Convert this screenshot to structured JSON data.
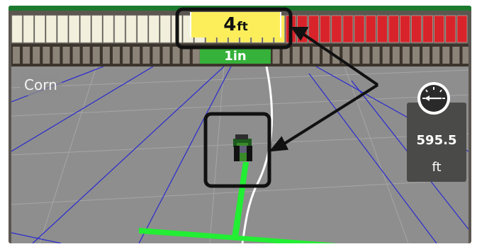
{
  "lightbar": {
    "offset_value": "4",
    "offset_unit": "ft",
    "left_color": "#f2f0dc",
    "right_color": "#d9232a",
    "center_color": "#fcee5a"
  },
  "track_error": {
    "label": "1in",
    "color": "#36b13a"
  },
  "field": {
    "crop": "Corn"
  },
  "distance": {
    "value": "595.5",
    "unit": "ft",
    "icon": "compass-icon"
  },
  "annotations": {
    "color": "#111111"
  }
}
